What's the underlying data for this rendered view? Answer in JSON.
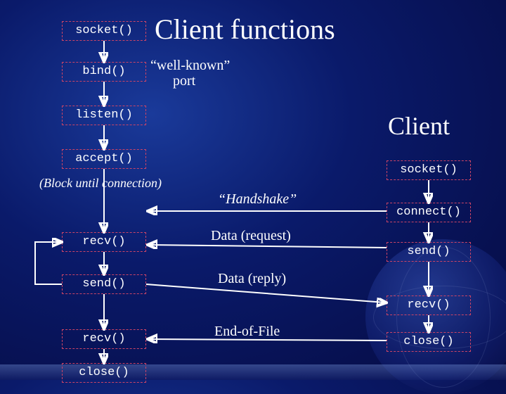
{
  "title": "Client functions",
  "client_heading": "Client",
  "server": {
    "socket": "socket()",
    "bind": "bind()",
    "listen": "listen()",
    "accept": "accept()",
    "block": "(Block until connection)",
    "recv1": "recv()",
    "send": "send()",
    "recv2": "recv()",
    "close": "close()"
  },
  "client": {
    "socket": "socket()",
    "connect": "connect()",
    "send": "send()",
    "recv": "recv()",
    "close": "close()"
  },
  "labels": {
    "wellknown1": "“well-known”",
    "wellknown2": "port",
    "handshake": "“Handshake”",
    "request": "Data (request)",
    "reply": "Data (reply)",
    "eof": "End-of-File"
  }
}
